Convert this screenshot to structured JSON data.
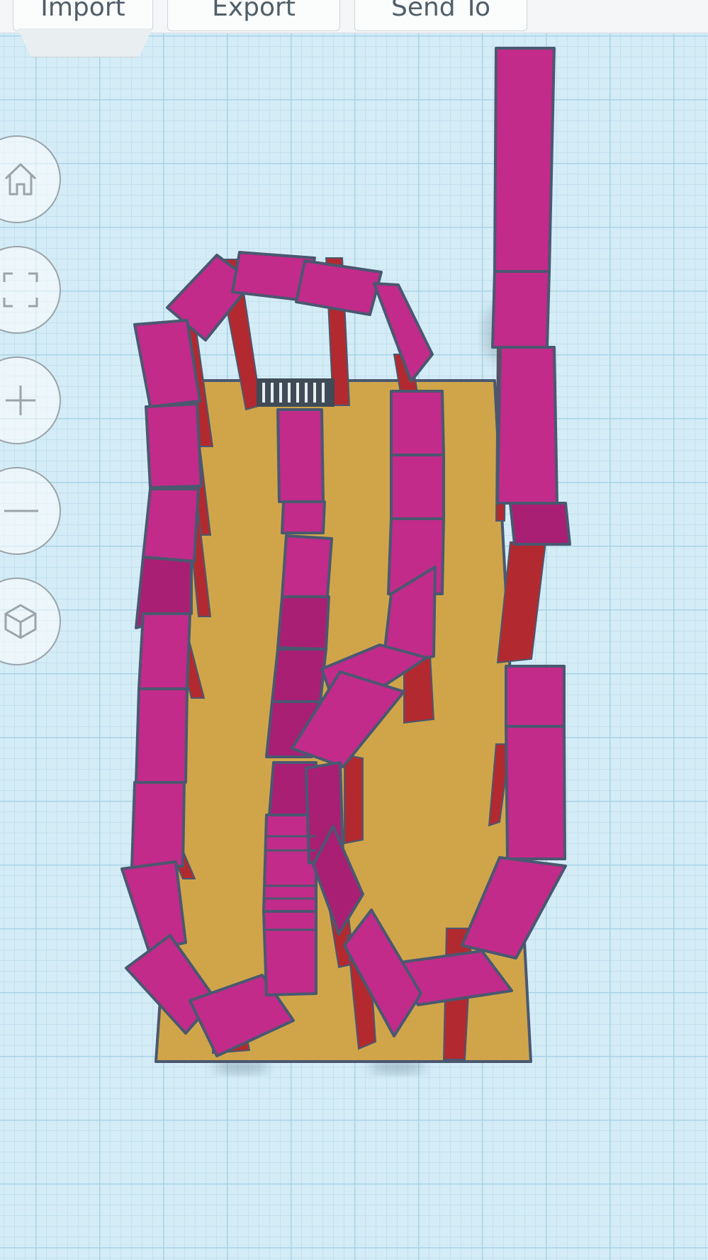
{
  "toolbar": {
    "import_label": "Import",
    "export_label": "Export",
    "send_to_label": "Send To"
  },
  "view_controls": [
    {
      "name": "home-view",
      "icon": "home-icon"
    },
    {
      "name": "fit-view",
      "icon": "fit-all-icon"
    },
    {
      "name": "zoom-in",
      "icon": "plus-icon"
    },
    {
      "name": "zoom-out",
      "icon": "minus-icon"
    },
    {
      "name": "perspective",
      "icon": "cube-icon"
    }
  ],
  "colors": {
    "workplane_bg": "#d4ecf6",
    "baseplate": "#d0a54a",
    "domino": "#c22b8a",
    "domino_shade": "#a91f74",
    "domino_side": "#b22a2f",
    "outline": "#4a5870"
  }
}
